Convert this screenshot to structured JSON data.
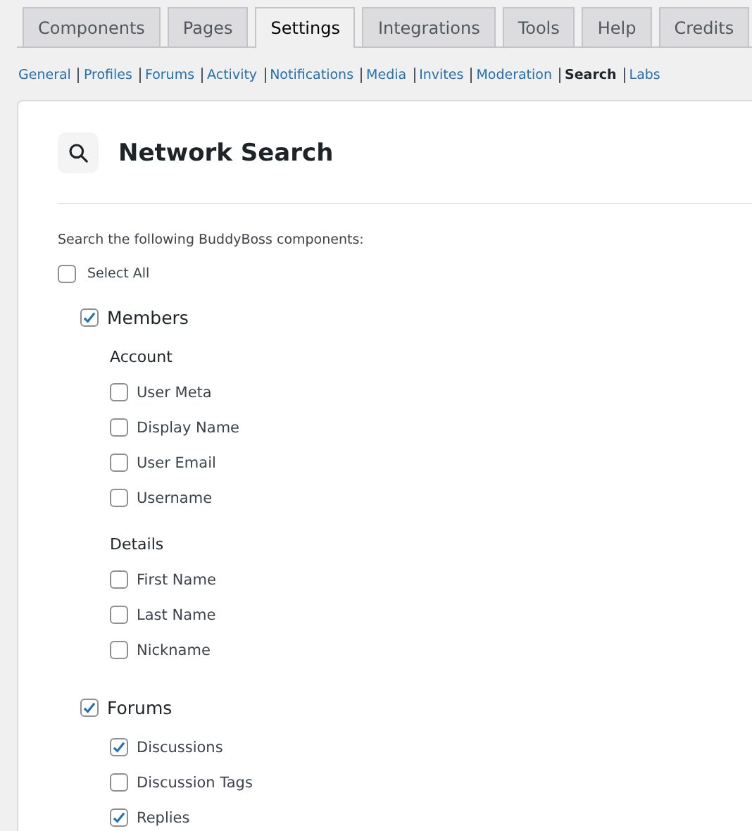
{
  "tabs": [
    {
      "label": "Components",
      "selected": false
    },
    {
      "label": "Pages",
      "selected": false
    },
    {
      "label": "Settings",
      "selected": true
    },
    {
      "label": "Integrations",
      "selected": false
    },
    {
      "label": "Tools",
      "selected": false
    },
    {
      "label": "Help",
      "selected": false
    },
    {
      "label": "Credits",
      "selected": false
    }
  ],
  "subnav": [
    {
      "label": "General",
      "selected": false
    },
    {
      "label": "Profiles",
      "selected": false
    },
    {
      "label": "Forums",
      "selected": false
    },
    {
      "label": "Activity",
      "selected": false
    },
    {
      "label": "Notifications",
      "selected": false
    },
    {
      "label": "Media",
      "selected": false
    },
    {
      "label": "Invites",
      "selected": false
    },
    {
      "label": "Moderation",
      "selected": false
    },
    {
      "label": "Search",
      "selected": true
    },
    {
      "label": "Labs",
      "selected": false
    }
  ],
  "panel": {
    "title": "Network Search",
    "intro": "Search the following BuddyBoss components:",
    "select_all": {
      "label": "Select All",
      "checked": false
    },
    "components": [
      {
        "label": "Members",
        "checked": true,
        "rows": [
          {
            "kind": "heading",
            "label": "Account"
          },
          {
            "kind": "option",
            "label": "User Meta",
            "checked": false
          },
          {
            "kind": "option",
            "label": "Display Name",
            "checked": false
          },
          {
            "kind": "option",
            "label": "User Email",
            "checked": false
          },
          {
            "kind": "option",
            "label": "Username",
            "checked": false
          },
          {
            "kind": "heading",
            "label": "Details"
          },
          {
            "kind": "option",
            "label": "First Name",
            "checked": false
          },
          {
            "kind": "option",
            "label": "Last Name",
            "checked": false
          },
          {
            "kind": "option",
            "label": "Nickname",
            "checked": false
          }
        ]
      },
      {
        "label": "Forums",
        "checked": true,
        "rows": [
          {
            "kind": "option",
            "label": "Discussions",
            "checked": true
          },
          {
            "kind": "option",
            "label": "Discussion Tags",
            "checked": false
          },
          {
            "kind": "option",
            "label": "Replies",
            "checked": true
          }
        ]
      }
    ]
  }
}
